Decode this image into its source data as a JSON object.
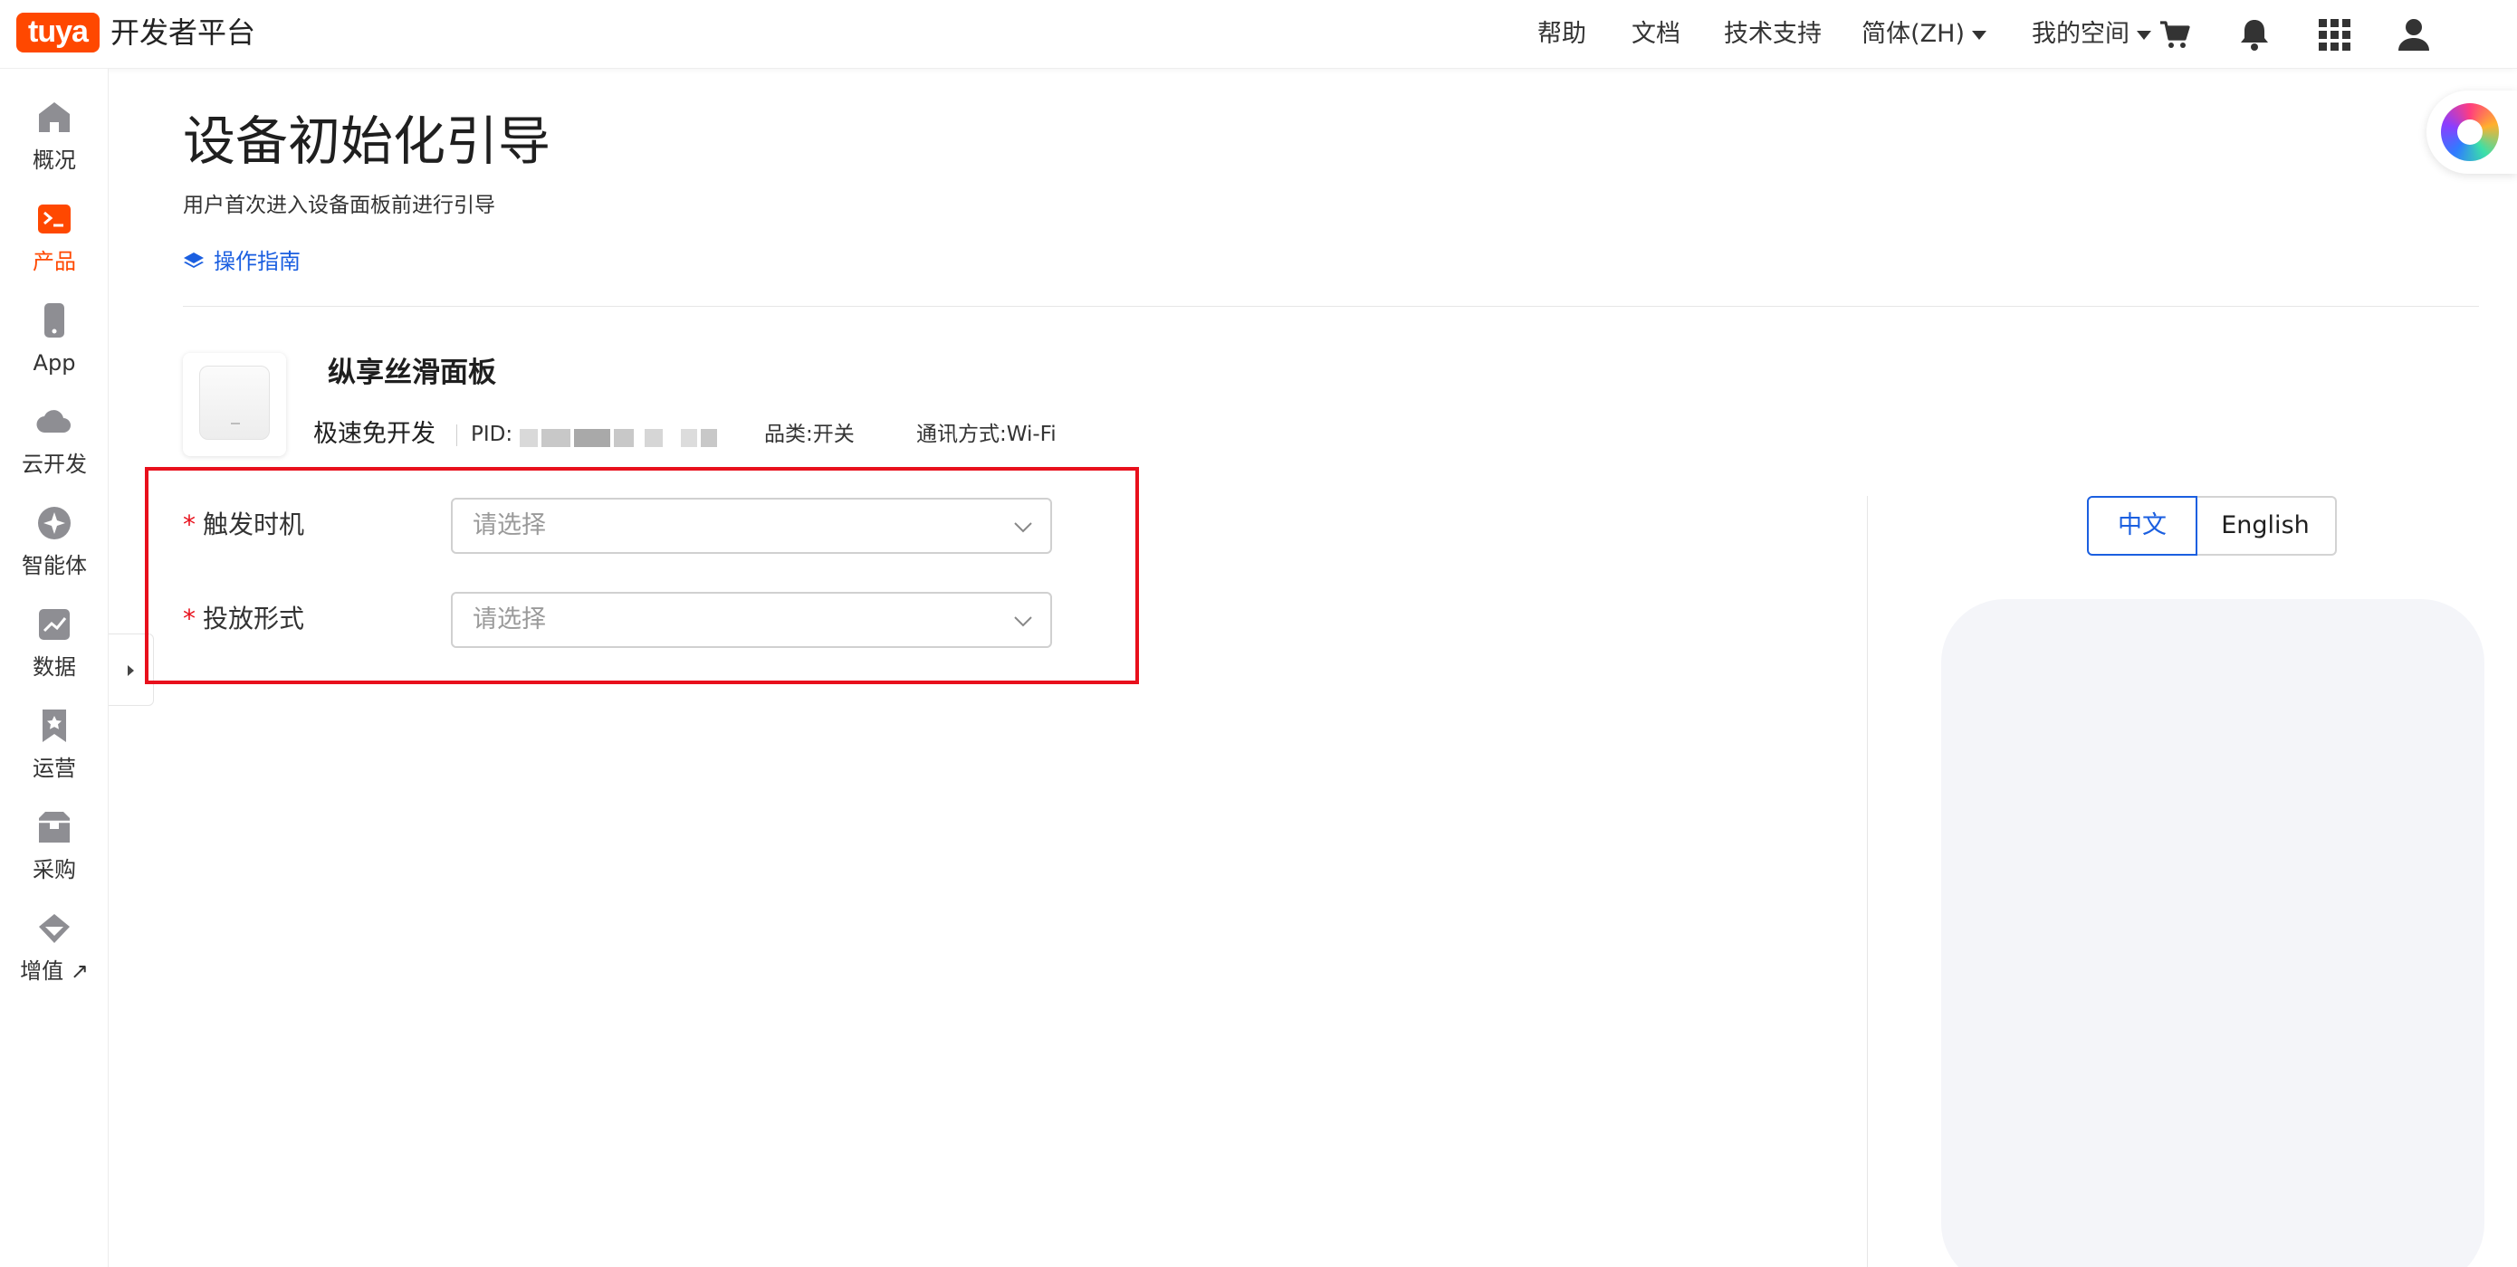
{
  "topbar": {
    "logo_text": "tuya",
    "brand_name": "开发者平台",
    "nav": {
      "help": "帮助",
      "docs": "文档",
      "support": "技术支持",
      "language": "简体(ZH)",
      "my_space": "我的空间"
    },
    "icons": [
      "cart-icon",
      "bell-icon",
      "apps-grid-icon",
      "user-icon"
    ]
  },
  "sidebar": {
    "items": [
      {
        "label": "概况",
        "icon": "home-icon",
        "active": false
      },
      {
        "label": "产品",
        "icon": "terminal-icon",
        "active": true
      },
      {
        "label": "App",
        "icon": "phone-icon",
        "active": false
      },
      {
        "label": "云开发",
        "icon": "cloud-icon",
        "active": false
      },
      {
        "label": "智能体",
        "icon": "sparkle-icon",
        "active": false
      },
      {
        "label": "数据",
        "icon": "chart-icon",
        "active": false
      },
      {
        "label": "运营",
        "icon": "bookmark-icon",
        "active": false
      },
      {
        "label": "采购",
        "icon": "box-icon",
        "active": false
      },
      {
        "label": "增值 ↗",
        "icon": "diamond-icon",
        "active": false
      }
    ]
  },
  "page": {
    "title": "设备初始化引导",
    "description": "用户首次进入设备面板前进行引导",
    "guide_link": "操作指南"
  },
  "product": {
    "name": "纵享丝滑面板",
    "dev_mode": "极速免开发",
    "pid_label": "PID:",
    "category": "品类:开关",
    "protocol": "通讯方式:Wi-Fi"
  },
  "form": {
    "required_mark": "*",
    "trigger": {
      "label": "触发时机",
      "placeholder": "请选择"
    },
    "display": {
      "label": "投放形式",
      "placeholder": "请选择"
    }
  },
  "preview": {
    "lang_zh": "中文",
    "lang_en": "English",
    "selected_lang": "中文"
  },
  "colors": {
    "brand": "#ff4800",
    "link": "#1b5fe0",
    "highlight": "#e8101c"
  }
}
